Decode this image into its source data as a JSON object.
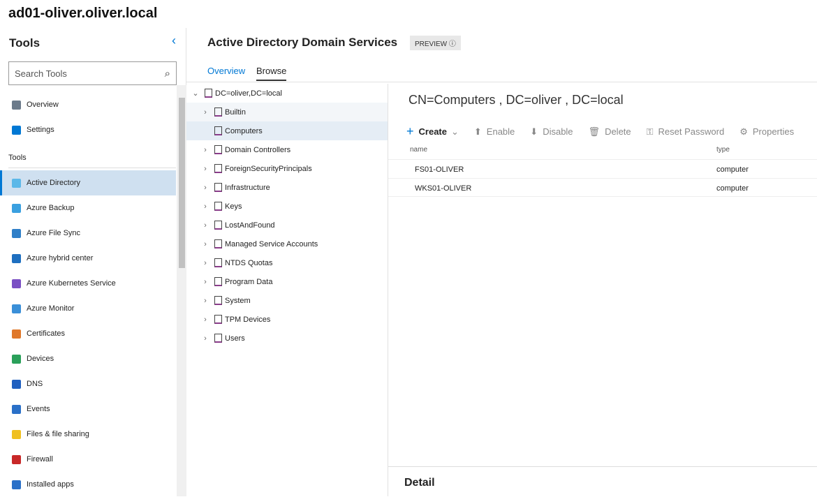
{
  "server": "ad01-oliver.oliver.local",
  "sidebar": {
    "title": "Tools",
    "search_placeholder": "Search Tools",
    "group_label": "Tools",
    "top_items": [
      {
        "label": "Overview",
        "color": "#6b7a8a"
      },
      {
        "label": "Settings",
        "color": "#0078d4"
      }
    ],
    "items": [
      {
        "label": "Active Directory",
        "color": "#5cb8e8",
        "selected": true
      },
      {
        "label": "Azure Backup",
        "color": "#3aa0e0"
      },
      {
        "label": "Azure File Sync",
        "color": "#2f7fc8"
      },
      {
        "label": "Azure hybrid center",
        "color": "#1e6fc0"
      },
      {
        "label": "Azure Kubernetes Service",
        "color": "#7a4fc4"
      },
      {
        "label": "Azure Monitor",
        "color": "#3a8fd8"
      },
      {
        "label": "Certificates",
        "color": "#e0782a"
      },
      {
        "label": "Devices",
        "color": "#2aa05a"
      },
      {
        "label": "DNS",
        "color": "#2060c0"
      },
      {
        "label": "Events",
        "color": "#2a70c8"
      },
      {
        "label": "Files & file sharing",
        "color": "#f0c020"
      },
      {
        "label": "Firewall",
        "color": "#c82828"
      },
      {
        "label": "Installed apps",
        "color": "#2a70c8"
      }
    ]
  },
  "main": {
    "title": "Active Directory Domain Services",
    "badge": "PREVIEW ⓘ",
    "tabs": [
      {
        "label": "Overview"
      },
      {
        "label": "Browse",
        "active": true
      }
    ],
    "tree": {
      "root": "DC=oliver,DC=local",
      "children": [
        {
          "label": "Builtin",
          "expandable": true
        },
        {
          "label": "Computers",
          "expandable": false,
          "selected": true
        },
        {
          "label": "Domain Controllers",
          "expandable": true
        },
        {
          "label": "ForeignSecurityPrincipals",
          "expandable": true
        },
        {
          "label": "Infrastructure",
          "expandable": true
        },
        {
          "label": "Keys",
          "expandable": true
        },
        {
          "label": "LostAndFound",
          "expandable": true
        },
        {
          "label": "Managed Service Accounts",
          "expandable": true
        },
        {
          "label": "NTDS Quotas",
          "expandable": true
        },
        {
          "label": "Program Data",
          "expandable": true
        },
        {
          "label": "System",
          "expandable": true
        },
        {
          "label": "TPM Devices",
          "expandable": true
        },
        {
          "label": "Users",
          "expandable": true
        }
      ]
    },
    "dn": "CN=Computers , DC=oliver , DC=local",
    "toolbar": {
      "create": "Create",
      "enable": "Enable",
      "disable": "Disable",
      "delete": "Delete",
      "reset": "Reset Password",
      "properties": "Properties"
    },
    "columns": {
      "name": "name",
      "type": "type"
    },
    "rows": [
      {
        "name": "FS01-OLIVER",
        "type": "computer"
      },
      {
        "name": "WKS01-OLIVER",
        "type": "computer"
      }
    ],
    "detail": "Detail"
  }
}
